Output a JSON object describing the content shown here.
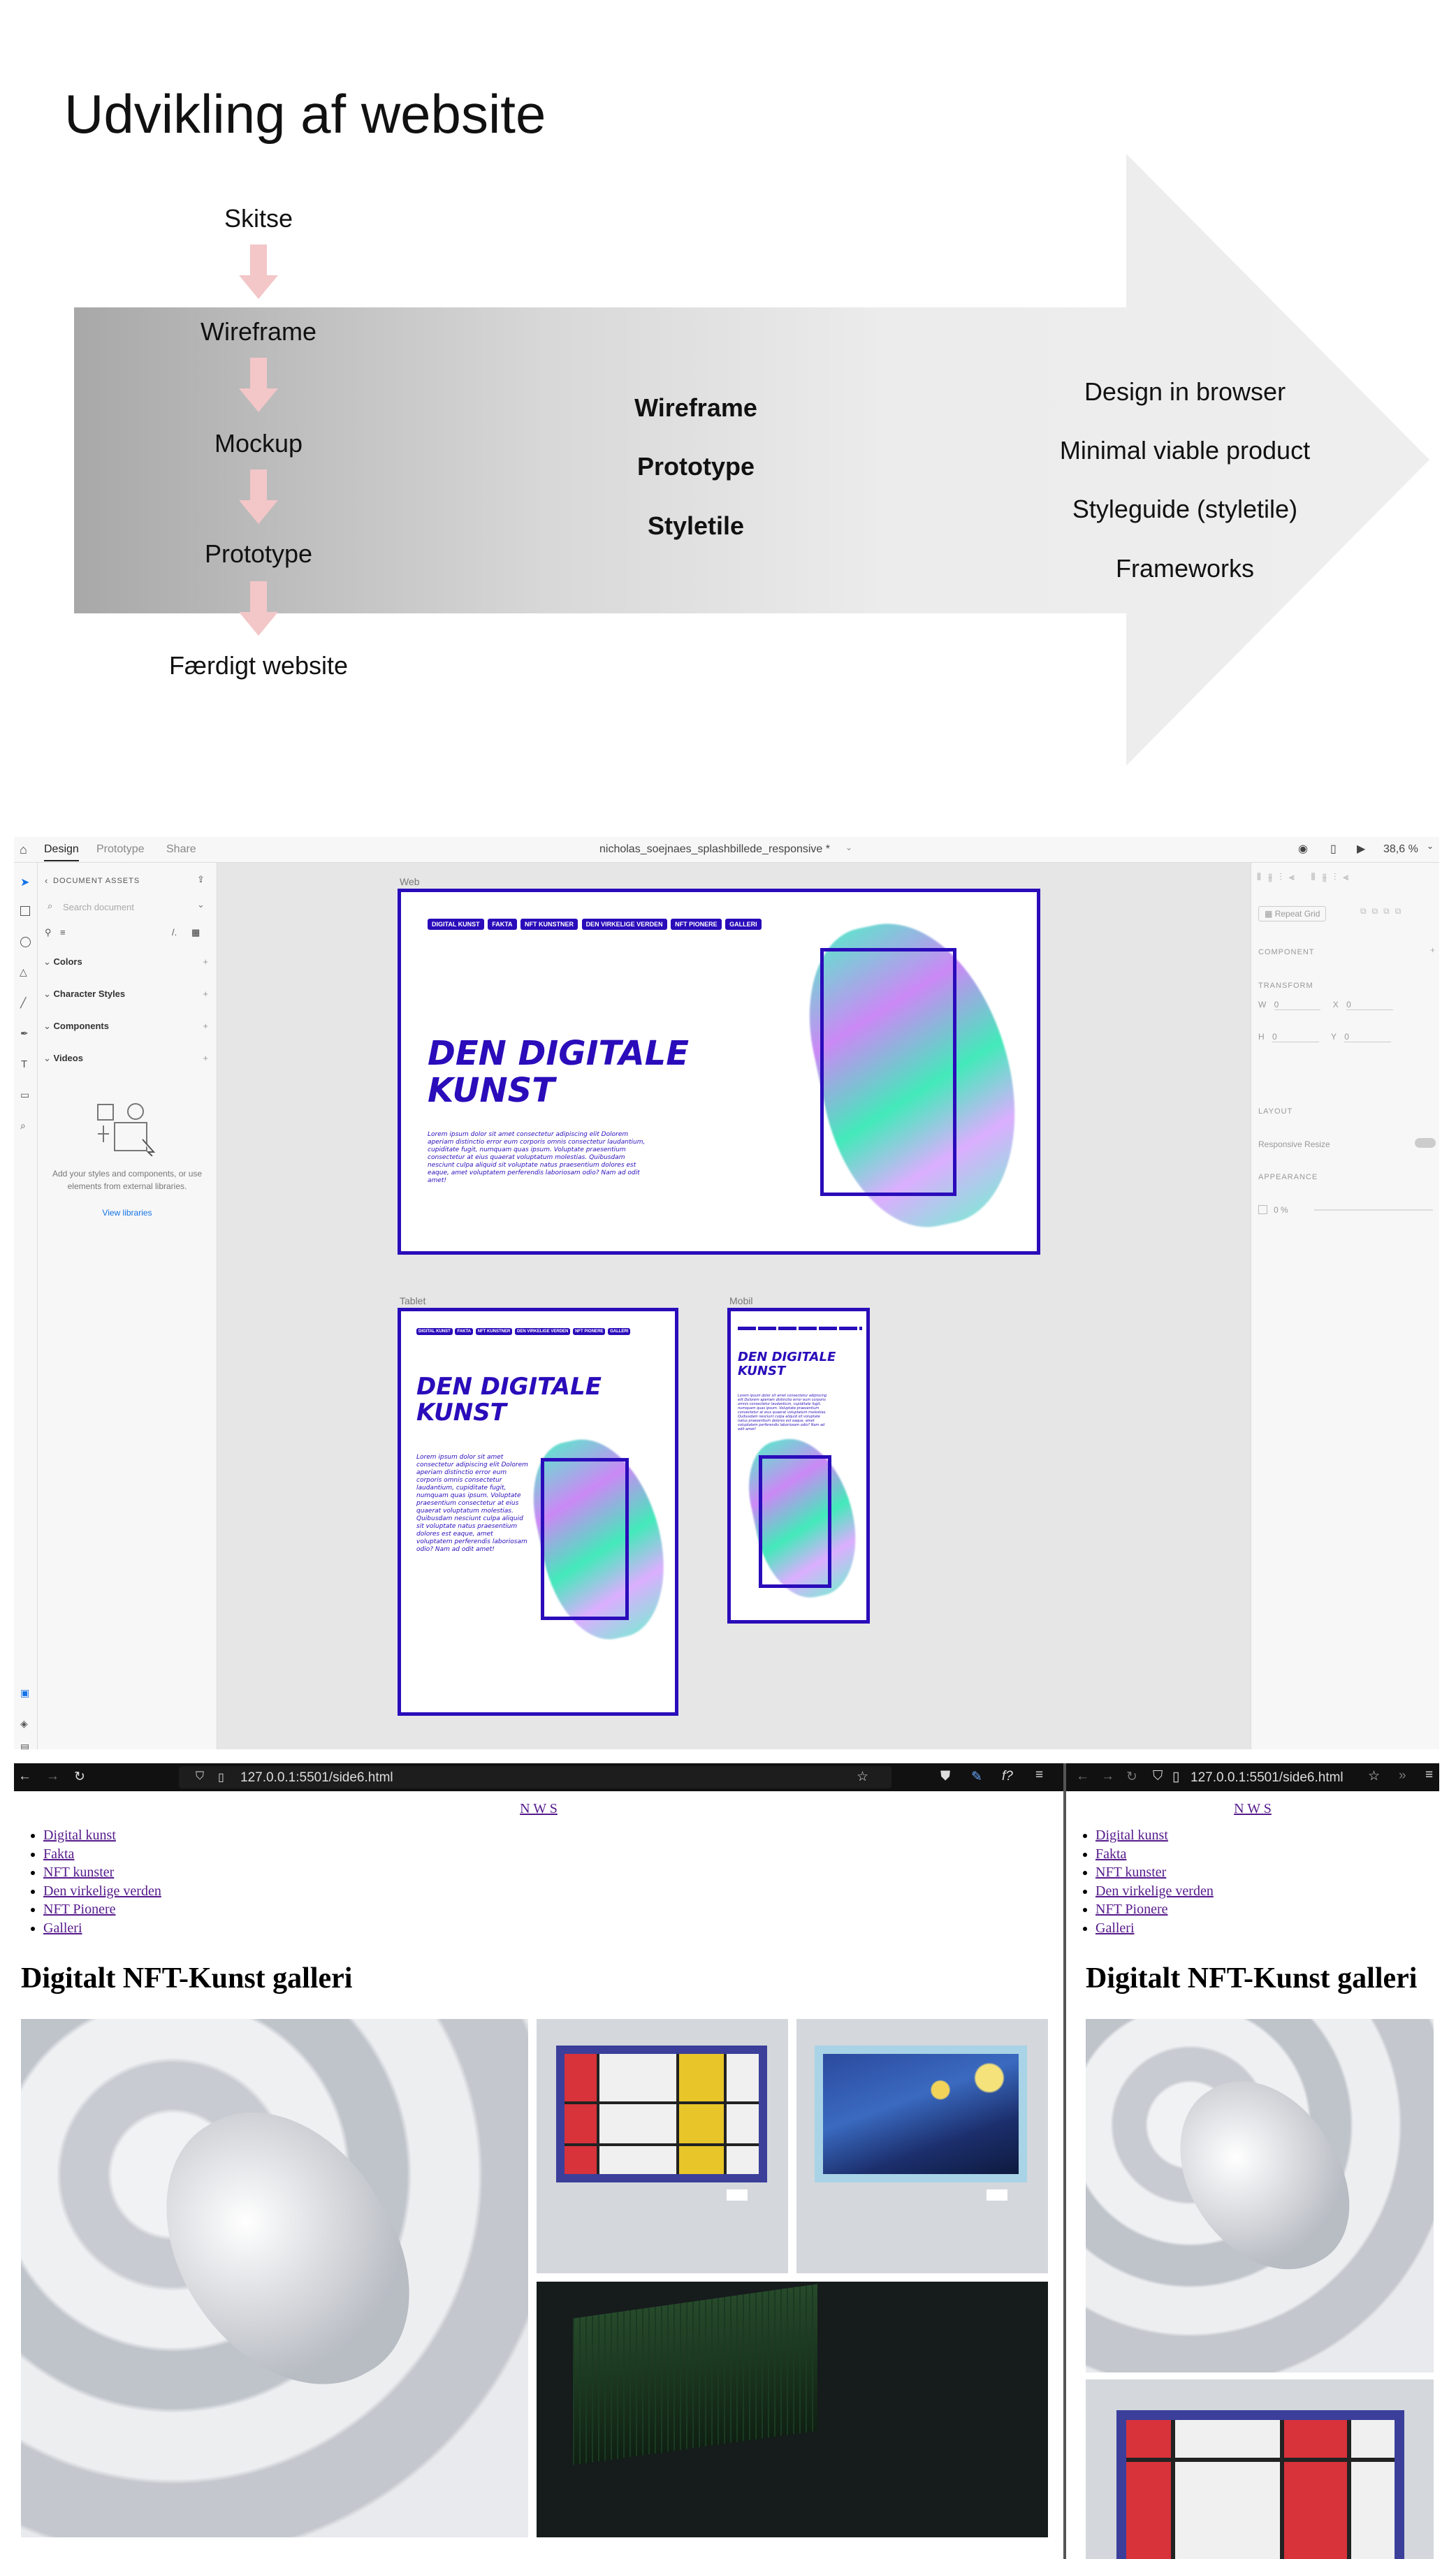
{
  "slide": {
    "title": "Udvikling af website",
    "steps": [
      "Skitse",
      "Wireframe",
      "Mockup",
      "Prototype",
      "Færdigt website"
    ],
    "middle": [
      "Wireframe",
      "Prototype",
      "Styletile"
    ],
    "right": [
      "Design in browser",
      "Minimal viable product",
      "Styleguide (styletile)",
      "Frameworks"
    ]
  },
  "xd": {
    "tabs": [
      "Design",
      "Prototype",
      "Share"
    ],
    "doc_title": "nicholas_soejnaes_splashbillede_responsive *",
    "zoom": "38,6 %",
    "assets": {
      "header": "DOCUMENT ASSETS",
      "search_placeholder": "Search document",
      "sections": [
        "Colors",
        "Character Styles",
        "Components",
        "Videos"
      ],
      "empty_text": "Add your styles and components, or use elements from external libraries.",
      "view_libraries": "View libraries"
    },
    "props": {
      "repeat_grid": "Repeat Grid",
      "component": "COMPONENT",
      "transform": "TRANSFORM",
      "w": "W",
      "x": "X",
      "h": "H",
      "y": "Y",
      "zero": "0",
      "layout": "LAYOUT",
      "responsive_resize": "Responsive Resize",
      "appearance": "APPEARANCE",
      "opacity": "0 %"
    },
    "artboards": {
      "web_label": "Web",
      "tablet_label": "Tablet",
      "mobile_label": "Mobil",
      "nav": [
        "DIGITAL KUNST",
        "FAKTA",
        "NFT KUNSTNER",
        "DEN VIRKELIGE VERDEN",
        "NFT PIONERE",
        "GALLERI"
      ],
      "hero_line1": "DEN DIGITALE",
      "hero_line2": "KUNST",
      "lorem": "Lorem ipsum dolor sit amet consectetur adipiscing elit Dolorem aperiam distinctio error eum corporis omnis consectetur laudantium, cupiditate fugit, numquam quas ipsum. Voluptate praesentium consectetur at eius quaerat voluptatum molestias. Quibusdam nesciunt culpa aliquid sit voluptate natus praesentium dolores est eaque, amet voluptatem perferendis laboriosam odio? Nam ad odit amet!"
    }
  },
  "browser_left": {
    "url": "127.0.0.1:5501/side6.html",
    "logo": "N W S",
    "nav": [
      "Digital kunst",
      "Fakta",
      "NFT kunster",
      "Den virkelige verden",
      "NFT Pionere",
      "Galleri"
    ],
    "heading": "Digitalt NFT-Kunst galleri"
  },
  "browser_right": {
    "url": "127.0.0.1:5501/side6.html",
    "logo": "N W S",
    "nav": [
      "Digital kunst",
      "Fakta",
      "NFT kunster",
      "Den virkelige verden",
      "NFT Pionere",
      "Galleri"
    ],
    "heading": "Digitalt NFT-Kunst galleri"
  },
  "colors": {
    "accent_blue": "#2a0cba",
    "arrow_pink": "#f3c6c8",
    "link": "#551a8b"
  }
}
